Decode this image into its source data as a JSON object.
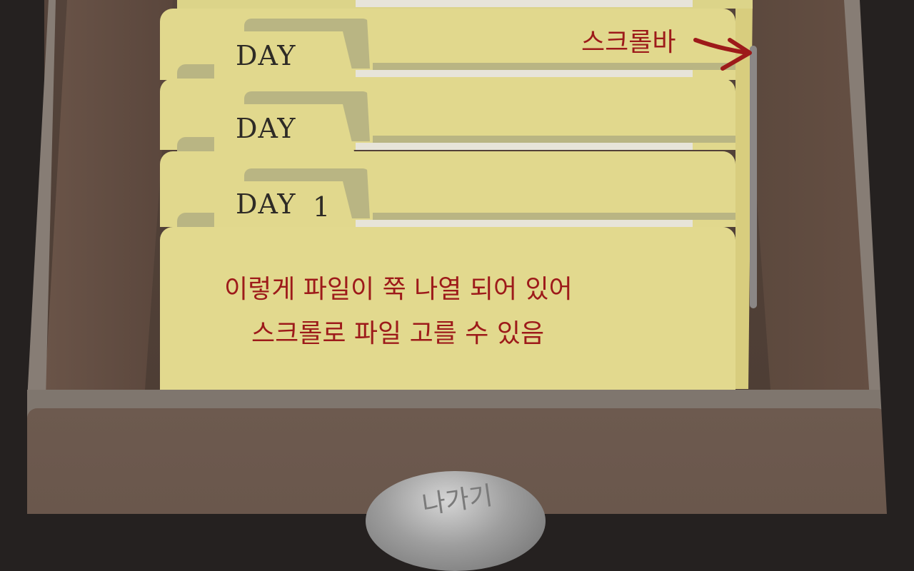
{
  "folders": [
    {
      "label": "DAY",
      "number": ""
    },
    {
      "label": "DAY",
      "number": ""
    },
    {
      "label": "DAY",
      "number": "1"
    }
  ],
  "annotations": {
    "scrollbar_note": "스크롤바",
    "list_note_line1": "이렇게 파일이 쭉 나열 되어 있어",
    "list_note_line2": "스크롤로 파일 고를 수 있음"
  },
  "exit_button": {
    "label": "나가기"
  },
  "colors": {
    "folder": "#e1d88d",
    "folder_tab": "#b9b583",
    "annotation": "#9d1a1a",
    "wood": "#6d5a4f",
    "knob": "#9e9e9e"
  }
}
